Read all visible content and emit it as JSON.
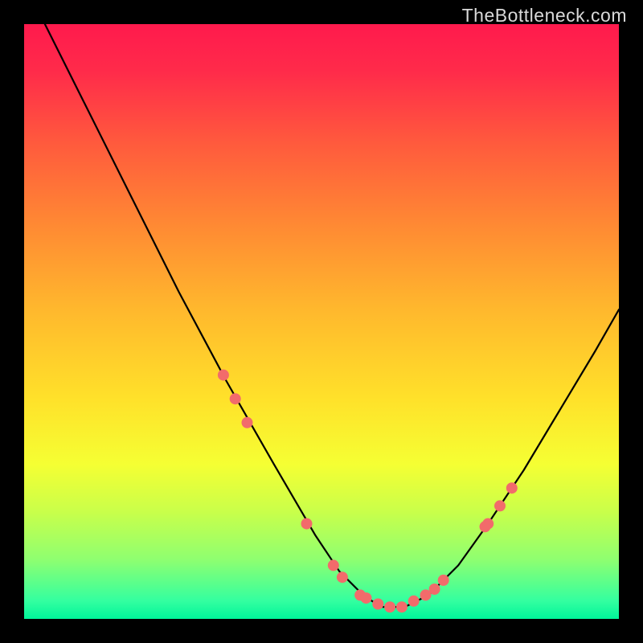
{
  "watermark": "TheBottleneck.com",
  "colors": {
    "frame": "#000000",
    "marker": "#f26b6b",
    "curve": "#000000"
  },
  "chart_data": {
    "type": "line",
    "title": "",
    "xlabel": "",
    "ylabel": "",
    "xlim": [
      0,
      100
    ],
    "ylim": [
      0,
      100
    ],
    "grid": false,
    "series": [
      {
        "name": "curve",
        "x": [
          3,
          10,
          18,
          26,
          34,
          42,
          49,
          53,
          57,
          60,
          64,
          68,
          73,
          78,
          84,
          90,
          96,
          100
        ],
        "y": [
          101,
          87,
          71,
          55,
          40,
          26,
          14,
          8,
          4,
          2,
          2,
          4,
          9,
          16,
          25,
          35,
          45,
          52
        ]
      }
    ],
    "markers": {
      "name": "highlighted-points",
      "x": [
        33.5,
        35.5,
        37.5,
        47.5,
        52.0,
        53.5,
        56.5,
        57.5,
        59.5,
        61.5,
        63.5,
        65.5,
        67.5,
        69.0,
        70.5,
        77.5,
        78.0,
        80.0,
        82.0
      ],
      "y": [
        41.0,
        37.0,
        33.0,
        16.0,
        9.0,
        7.0,
        4.0,
        3.5,
        2.5,
        2.0,
        2.0,
        3.0,
        4.0,
        5.0,
        6.5,
        15.5,
        16.0,
        19.0,
        22.0
      ]
    }
  }
}
